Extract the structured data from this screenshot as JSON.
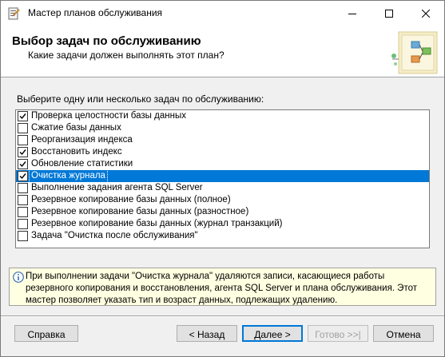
{
  "window": {
    "title": "Мастер планов обслуживания",
    "icons": [
      "app-icon",
      "minimize-icon",
      "maximize-icon",
      "close-icon"
    ]
  },
  "header": {
    "title": "Выбор задач по обслуживанию",
    "subtitle": "Какие задачи должен выполнять этот план?"
  },
  "prompt": "Выберите одну или несколько задач по обслуживанию:",
  "tasks": [
    {
      "label": "Проверка целостности базы данных",
      "checked": true,
      "selected": false
    },
    {
      "label": "Сжатие базы данных",
      "checked": false,
      "selected": false
    },
    {
      "label": "Реорганизация индекса",
      "checked": false,
      "selected": false
    },
    {
      "label": "Восстановить индекс",
      "checked": true,
      "selected": false
    },
    {
      "label": "Обновление статистики",
      "checked": true,
      "selected": false
    },
    {
      "label": "Очистка журнала",
      "checked": true,
      "selected": true
    },
    {
      "label": "Выполнение задания агента SQL Server",
      "checked": false,
      "selected": false
    },
    {
      "label": "Резервное копирование базы данных (полное)",
      "checked": false,
      "selected": false
    },
    {
      "label": "Резервное копирование базы данных (разностное)",
      "checked": false,
      "selected": false
    },
    {
      "label": "Резервное копирование базы данных (журнал транзакций)",
      "checked": false,
      "selected": false
    },
    {
      "label": "Задача \"Очистка после обслуживания\"",
      "checked": false,
      "selected": false
    }
  ],
  "info": {
    "text": "При выполнении задачи \"Очистка журнала\" удаляются записи, касающиеся работы резервного копирования и восстановления, агента SQL Server и плана обслуживания.  Этот мастер позволяет указать тип и возраст данных, подлежащих удалению."
  },
  "buttons": {
    "help": "Справка",
    "back": "< Назад",
    "next": "Далее >",
    "finish": "Готово >>|",
    "cancel": "Отмена"
  },
  "colors": {
    "selection": "#0078d7",
    "info_background": "#ffffe1",
    "dialog_background": "#f0f0f0"
  }
}
